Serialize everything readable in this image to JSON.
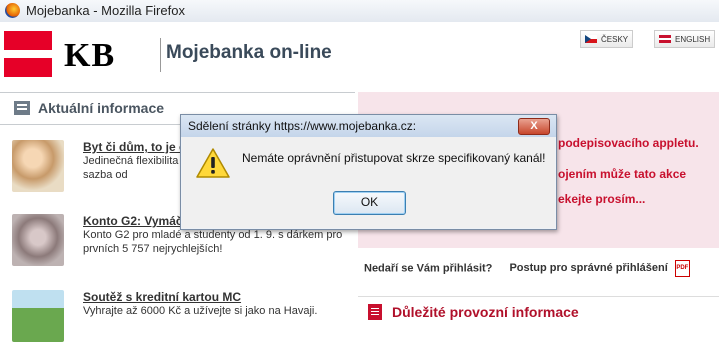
{
  "window": {
    "title": "Mojebanka - Mozilla Firefox"
  },
  "header": {
    "logo_text": "KB",
    "brand": "Mojebanka on-line",
    "lang_czech": "ČESKY",
    "lang_english": "ENGLISH"
  },
  "left": {
    "section_title": "Aktuální informace",
    "news": [
      {
        "title": "Byt či dům, to je o",
        "text": "Jedinečná flexibilita p možnost mimořádné a úroková sazba od"
      },
      {
        "title": "Konto G2: Vymáčk",
        "text": "Konto G2 pro mladé a studenty od 1. 9. s dárkem pro prvních 5 757 nejrychlejších!"
      },
      {
        "title": "Soutěž s kreditní kartou MC",
        "text": "Vyhrajte až 6000 Kč a užívejte si jako na Havaji."
      }
    ]
  },
  "right": {
    "pink_line1": "podepisovacího appletu.",
    "pink_line2": "ojením může tato akce",
    "pink_line3": "ekejte prosím...",
    "link_help": "Nedaří se Vám přihlásit?",
    "link_procedure": "Postup pro správné přihlášení",
    "important_title": "Důležité provozní informace"
  },
  "dialog": {
    "title": "Sdělení stránky https://www.mojebanka.cz:",
    "message": "Nemáte oprávnění přistupovat skrze specifikovaný kanál!",
    "ok_label": "OK",
    "close_label": "X"
  }
}
